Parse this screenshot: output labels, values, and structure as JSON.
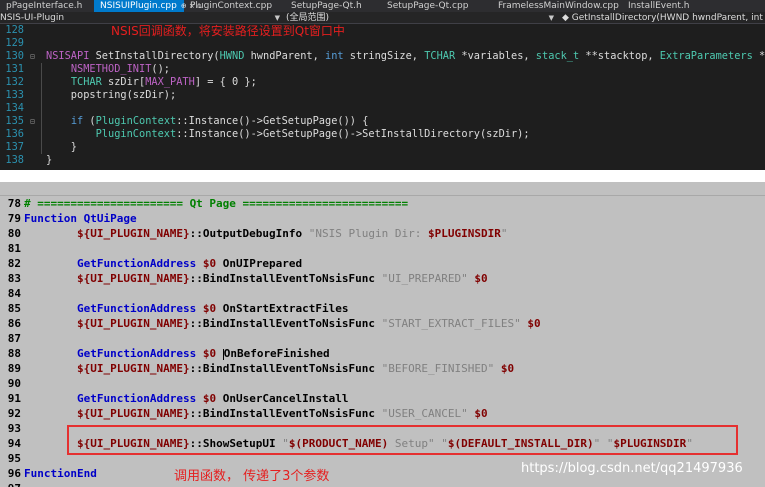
{
  "vs": {
    "tabs": [
      {
        "label": "pPageInterface.h",
        "active": false
      },
      {
        "label": "NSISUIPlugin.cpp",
        "active": true,
        "icons": "⊕ × ▫"
      },
      {
        "label": "PluginContext.cpp",
        "active": false
      },
      {
        "label": "SetupPage-Qt.h",
        "active": false
      },
      {
        "label": "SetupPage-Qt.cpp",
        "active": false
      },
      {
        "label": "FramelessMainWindow.cpp",
        "active": false
      },
      {
        "label": "InstallEvent.h",
        "active": false
      }
    ],
    "nav": {
      "project": "NSIS-UI-Plugin",
      "scope": "(全局范围)",
      "member": "◆ GetInstallDirectory(HWND hwndParent, int strin"
    },
    "annotation": "NSIS回调函数，将安装路径设置到Qt窗口中",
    "lines": [
      {
        "n": "128",
        "gutter": "",
        "indent": false,
        "html": ""
      },
      {
        "n": "129",
        "gutter": "",
        "indent": false,
        "html": ""
      },
      {
        "n": "130",
        "gutter": "⊟",
        "indent": false,
        "html": "<span class=\"mc\">NSISAPI</span> SetInstallDirectory(<span class=\"ty\">HWND</span> hwndParent, <span class=\"kw\">int</span> stringSize, <span class=\"ty\">TCHAR</span> *variables, <span class=\"ty\">stack_t</span> **stacktop, <span class=\"ty\">ExtraParameters</span> *extra) {"
      },
      {
        "n": "131",
        "gutter": "",
        "indent": true,
        "html": "    <span class=\"mc\">NSMETHOD_INIT</span>();"
      },
      {
        "n": "132",
        "gutter": "",
        "indent": true,
        "html": "    <span class=\"ty\">TCHAR</span> szDir[<span class=\"mc\">MAX_PATH</span>] = { 0 };"
      },
      {
        "n": "133",
        "gutter": "",
        "indent": true,
        "html": "    popstring(szDir);"
      },
      {
        "n": "134",
        "gutter": "",
        "indent": true,
        "html": ""
      },
      {
        "n": "135",
        "gutter": "⊟",
        "indent": true,
        "html": "    <span class=\"kw\">if</span> (<span class=\"ty\">PluginContext</span>::Instance()->GetSetupPage()) {"
      },
      {
        "n": "136",
        "gutter": "",
        "indent": true,
        "html": "        <span class=\"ty\">PluginContext</span>::Instance()->GetSetupPage()->SetInstallDirectory(szDir);"
      },
      {
        "n": "137",
        "gutter": "",
        "indent": true,
        "html": "    }"
      },
      {
        "n": "138",
        "gutter": "",
        "indent": false,
        "html": "}"
      }
    ]
  },
  "nsis": {
    "annotation": "调用函数， 传递了3个参数",
    "watermark": "https://blog.csdn.net/qq21497936",
    "lines": [
      {
        "n": "78",
        "html": "<span class=\"ns-cmt\"># ====================== Qt Page =========================</span>"
      },
      {
        "n": "79",
        "html": "<span class=\"ns-fn\">Function QtUiPage</span>"
      },
      {
        "n": "80",
        "html": "        <span class=\"ns-var\">${UI_PLUGIN_NAME}</span>::OutputDebugInfo <span class=\"ns-str\">\"NSIS Plugin Dir: </span><span class=\"ns-var\">$PLUGINSDIR</span><span class=\"ns-str\">\"</span>"
      },
      {
        "n": "81",
        "html": ""
      },
      {
        "n": "82",
        "html": "        <span class=\"ns-fn\">GetFunctionAddress</span> <span class=\"ns-var\">$0</span> OnUIPrepared"
      },
      {
        "n": "83",
        "html": "        <span class=\"ns-var\">${UI_PLUGIN_NAME}</span>::BindInstallEventToNsisFunc <span class=\"ns-str\">\"UI_PREPARED\"</span> <span class=\"ns-var\">$0</span>"
      },
      {
        "n": "84",
        "html": ""
      },
      {
        "n": "85",
        "html": "        <span class=\"ns-fn\">GetFunctionAddress</span> <span class=\"ns-var\">$0</span> OnStartExtractFiles"
      },
      {
        "n": "86",
        "html": "        <span class=\"ns-var\">${UI_PLUGIN_NAME}</span>::BindInstallEventToNsisFunc <span class=\"ns-str\">\"START_EXTRACT_FILES\"</span> <span class=\"ns-var\">$0</span>"
      },
      {
        "n": "87",
        "html": ""
      },
      {
        "n": "88",
        "html": "        <span class=\"ns-fn\">GetFunctionAddress</span> <span class=\"ns-var\">$0</span> <span class=\"ns-cursor\"></span>OnBeforeFinished"
      },
      {
        "n": "89",
        "html": "        <span class=\"ns-var\">${UI_PLUGIN_NAME}</span>::BindInstallEventToNsisFunc <span class=\"ns-str\">\"BEFORE_FINISHED\"</span> <span class=\"ns-var\">$0</span>"
      },
      {
        "n": "90",
        "html": ""
      },
      {
        "n": "91",
        "html": "        <span class=\"ns-fn\">GetFunctionAddress</span> <span class=\"ns-var\">$0</span> OnUserCancelInstall"
      },
      {
        "n": "92",
        "html": "        <span class=\"ns-var\">${UI_PLUGIN_NAME}</span>::BindInstallEventToNsisFunc <span class=\"ns-str\">\"USER_CANCEL\"</span> <span class=\"ns-var\">$0</span>"
      },
      {
        "n": "93",
        "html": ""
      },
      {
        "n": "94",
        "html": "        <span class=\"ns-var\">${UI_PLUGIN_NAME}</span>::ShowSetupUI <span class=\"ns-str\">\"</span><span class=\"ns-var\">$(PRODUCT_NAME)</span><span class=\"ns-str\"> Setup\" \"</span><span class=\"ns-var\">$(DEFAULT_INSTALL_DIR)</span><span class=\"ns-str\">\" \"</span><span class=\"ns-var\">$PLUGINSDIR</span><span class=\"ns-str\">\"</span>"
      },
      {
        "n": "95",
        "html": ""
      },
      {
        "n": "96",
        "html": "<span class=\"ns-fn\">FunctionEnd</span>"
      },
      {
        "n": "97",
        "html": ""
      }
    ]
  }
}
